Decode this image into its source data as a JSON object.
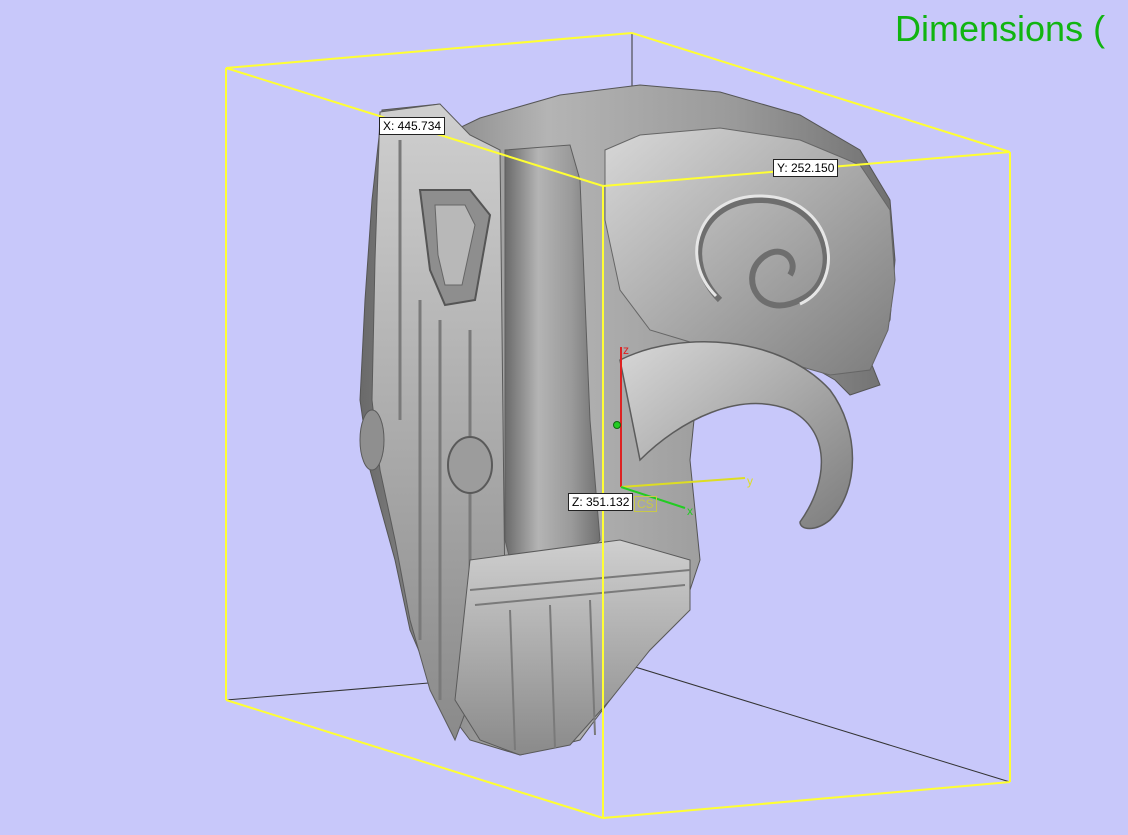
{
  "viewport": {
    "title": "Dimensions (",
    "background": "#c8c8fa",
    "bbox_color": "#ffff33",
    "measurements": {
      "x": "X: 445.734",
      "y": "Y: 252.150",
      "z": "Z: 351.132"
    },
    "gizmo": {
      "cs_label": "CS",
      "axis_x": "x",
      "axis_y": "y",
      "axis_z": "z",
      "x_color": "#22cc22",
      "y_color": "#dddd22",
      "z_color": "#dd2222"
    },
    "model": "carved mask sculpture (mesh)"
  }
}
